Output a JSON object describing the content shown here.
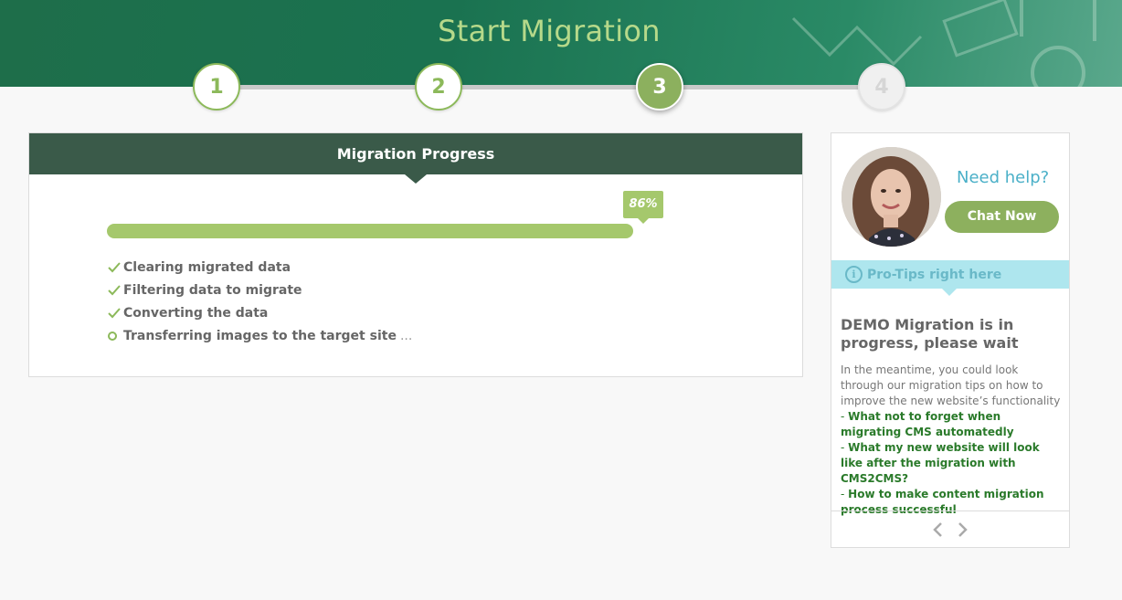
{
  "header": {
    "title": "Start Migration"
  },
  "stepper": {
    "steps": [
      {
        "label": "1",
        "state": "completed"
      },
      {
        "label": "2",
        "state": "completed"
      },
      {
        "label": "3",
        "state": "active"
      },
      {
        "label": "4",
        "state": "disabled"
      }
    ]
  },
  "progress": {
    "title": "Migration Progress",
    "percent_label": "86%",
    "percent_value": 86,
    "tasks": [
      {
        "label": "Clearing migrated data",
        "status": "done",
        "icon": "check-icon"
      },
      {
        "label": "Filtering data to migrate",
        "status": "done",
        "icon": "check-icon"
      },
      {
        "label": "Converting the data",
        "status": "done",
        "icon": "check-icon"
      },
      {
        "label": "Transferring images to the target site",
        "status": "in-progress",
        "icon": "circle-icon",
        "suffix": "..."
      }
    ]
  },
  "help": {
    "need_help": "Need help?",
    "chat_button": "Chat Now",
    "tips_bar": "Pro-Tips right here",
    "tips_title": "DEMO Migration is in progress, please wait",
    "tips_text": "In the meantime, you could look through our migration tips on how to improve the new website’s functionality",
    "links": [
      "What not to forget when migrating CMS automatedly",
      "What my new website will look like after the migration with CMS2CMS?",
      "How to make content migration process successful"
    ],
    "link_prefix": "- "
  },
  "colors": {
    "accent_green": "#8cb95a",
    "bar_green": "#a5c86c",
    "header_dark": "#3a5a49",
    "help_blue": "#4bb0c8",
    "link_green": "#2a7a2a"
  }
}
